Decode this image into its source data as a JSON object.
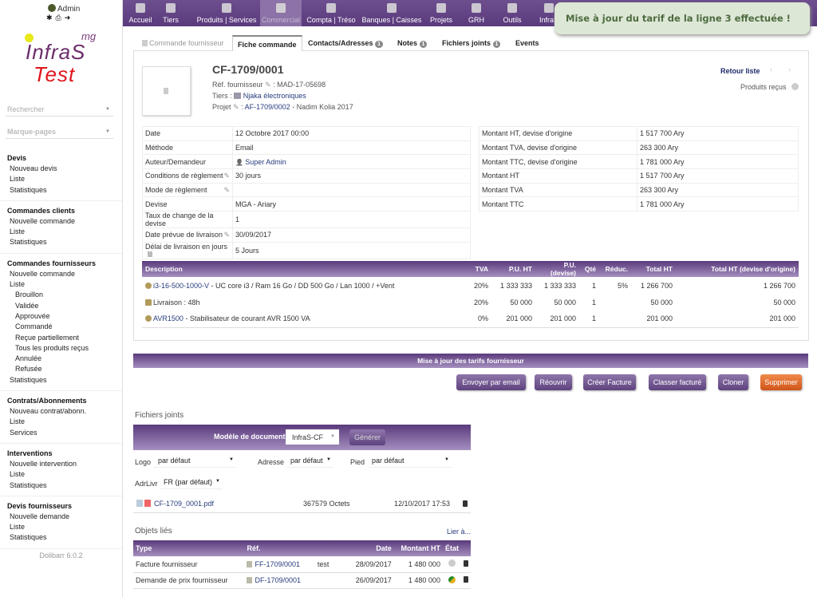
{
  "user": {
    "name": "Admin"
  },
  "logo": {
    "mg": "mg",
    "line1": "InfraS",
    "line2": "Test"
  },
  "sidebar": {
    "search_placeholder": "Rechercher",
    "bookmarks": "Marque-pages",
    "groups": [
      {
        "title": "Devis",
        "items": [
          "Nouveau devis",
          "Liste",
          "Statistiques"
        ]
      },
      {
        "title": "Commandes clients",
        "items": [
          "Nouvelle commande",
          "Liste",
          "Statistiques"
        ]
      },
      {
        "title": "Commandes fournisseurs",
        "items": [
          "Nouvelle commande",
          "Liste"
        ],
        "subitems": [
          "Brouillon",
          "Validée",
          "Approuvée",
          "Commandé",
          "Reçue partiellement",
          "Tous les produits reçus",
          "Annulée",
          "Refusée"
        ],
        "after": "Statistiques"
      },
      {
        "title": "Contrats/Abonnements",
        "items": [
          "Nouveau contrat/abonn.",
          "Liste",
          "Services"
        ]
      },
      {
        "title": "Interventions",
        "items": [
          "Nouvelle intervention",
          "Liste",
          "Statistiques"
        ]
      },
      {
        "title": "Devis fournisseurs",
        "items": [
          "Nouvelle demande",
          "Liste",
          "Statistiques"
        ]
      }
    ],
    "version": "Dolibarr 6.0.2"
  },
  "topnav": [
    "Accueil",
    "Tiers",
    "Produits | Services",
    "Commercial",
    "Compta | Tréso",
    "Banques | Caisses",
    "Projets",
    "GRH",
    "Outils",
    "InfraS"
  ],
  "toast": "Mise à jour du tarif de la ligne 3 effectuée !",
  "tabs": {
    "t0": "Commande fournisseur",
    "t1": "Fiche commande",
    "t2": "Contacts/Adresses",
    "t2b": "1",
    "t3": "Notes",
    "t3b": "1",
    "t4": "Fichiers joints",
    "t4b": "1",
    "t5": "Events"
  },
  "header": {
    "ref": "CF-1709/0001",
    "ref_supplier_label": "Réf. fournisseur",
    "ref_supplier": "MAD-17-05698",
    "tiers_label": "Tiers :",
    "tiers": "Njaka électroniques",
    "project_label": "Projet",
    "project_ref": "AF-1709/0002",
    "project_name": "- Nadim Kolia 2017",
    "back": "Retour liste",
    "received": "Produits reçus"
  },
  "fields": [
    [
      "Date",
      "12 Octobre 2017 00:00"
    ],
    [
      "Méthode",
      "Email"
    ],
    [
      "Auteur/Demandeur",
      "Super Admin"
    ],
    [
      "Conditions de règlement",
      "30 jours"
    ],
    [
      "Mode de règlement",
      ""
    ],
    [
      "Devise",
      "MGA - Ariary"
    ],
    [
      "Taux de change de la devise",
      "1"
    ],
    [
      "Date prévue de livraison",
      "30/09/2017"
    ],
    [
      "Délai de livraison en jours",
      "5 Jours"
    ]
  ],
  "amounts": [
    [
      "Montant HT, devise d'origine",
      "1 517 700 Ary"
    ],
    [
      "Montant TVA, devise d'origine",
      "263 300 Ary"
    ],
    [
      "Montant TTC, devise d'origine",
      "1 781 000 Ary"
    ],
    [
      "Montant HT",
      "1 517 700 Ary"
    ],
    [
      "Montant TVA",
      "263 300 Ary"
    ],
    [
      "Montant TTC",
      "1 781 000 Ary"
    ]
  ],
  "lines": {
    "headers": [
      "Description",
      "TVA",
      "P.U. HT",
      "P.U. (devise)",
      "Qté",
      "Réduc.",
      "Total HT",
      "Total HT (devise d'origine)"
    ],
    "rows": [
      {
        "ref": "i3-16-500-1000-V",
        "desc": " - UC core i3 / Ram 16 Go / DD 500 Go / Lan 1000 / +Vent",
        "cells": [
          "20%",
          "1 333 333",
          "1 333 333",
          "1",
          "5%",
          "1 266 700",
          "1 266 700"
        ]
      },
      {
        "ref": "",
        "desc": "Livraison : 48h",
        "cells": [
          "20%",
          "50 000",
          "50 000",
          "1",
          "",
          "50 000",
          "50 000"
        ]
      },
      {
        "ref": "AVR1500",
        "desc": " - Stabilisateur de courant AVR 1500 VA",
        "cells": [
          "0%",
          "201 000",
          "201 000",
          "1",
          "",
          "201 000",
          "201 000"
        ]
      }
    ]
  },
  "update_bar": "Mise à jour des tarifs fournisseur",
  "actions": [
    "Envoyer par email",
    "Réouvrir",
    "Créer Facture",
    "Classer facturé",
    "Cloner",
    "Supprimer"
  ],
  "files": {
    "title": "Fichiers joints",
    "model_label": "Modèle de document",
    "model": "InfraS-CF",
    "generate": "Générer",
    "logo_label": "Logo",
    "logo": "par défaut",
    "address_label": "Adresse",
    "address": "par défaut",
    "footer_label": "Pied",
    "footer": "par défaut",
    "adr_label": "AdrLivr",
    "adr": "FR (par défaut)",
    "file": "CF-1709_0001.pdf",
    "size": "367579 Octets",
    "date": "12/10/2017 17:53"
  },
  "linked": {
    "title": "Objets liés",
    "link": "Lier à...",
    "headers": [
      "Type",
      "Réf.",
      "",
      "Date",
      "Montant HT",
      "État",
      ""
    ],
    "rows": [
      [
        "Facture fournisseur",
        "FF-1709/0001",
        "test",
        "28/09/2017",
        "1 480 000"
      ],
      [
        "Demande de prix fournisseur",
        "DF-1709/0001",
        "",
        "26/09/2017",
        "1 480 000"
      ]
    ]
  },
  "colors": {
    "accent": "#5a3a7c",
    "delete": "#e06a2c",
    "toast_bg": "#dde7d6"
  }
}
